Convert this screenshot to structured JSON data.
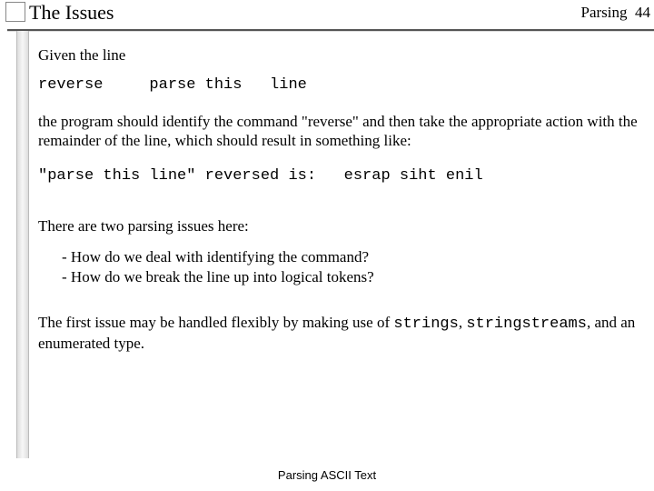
{
  "header": {
    "title": "The Issues",
    "section": "Parsing",
    "page": "44"
  },
  "body": {
    "p1": "Given the line",
    "code1": "reverse     parse this   line",
    "p2": "the program should identify the command \"reverse\" and then take the appropriate action with the remainder of the line, which should result in something like:",
    "code2": "\"parse this line\" reversed is:   esrap siht enil",
    "p3": "There are two parsing issues here:",
    "bullets": {
      "b1": "-  How do we deal with identifying the command?",
      "b2": "-  How do we break the line up into logical tokens?"
    },
    "p4a": "The first issue may be handled flexibly by making use of ",
    "p4code1": "strings",
    "p4b": ", ",
    "p4code2": "stringstreams",
    "p4c": ", and an enumerated type."
  },
  "footer": {
    "text": "Parsing ASCII Text"
  }
}
